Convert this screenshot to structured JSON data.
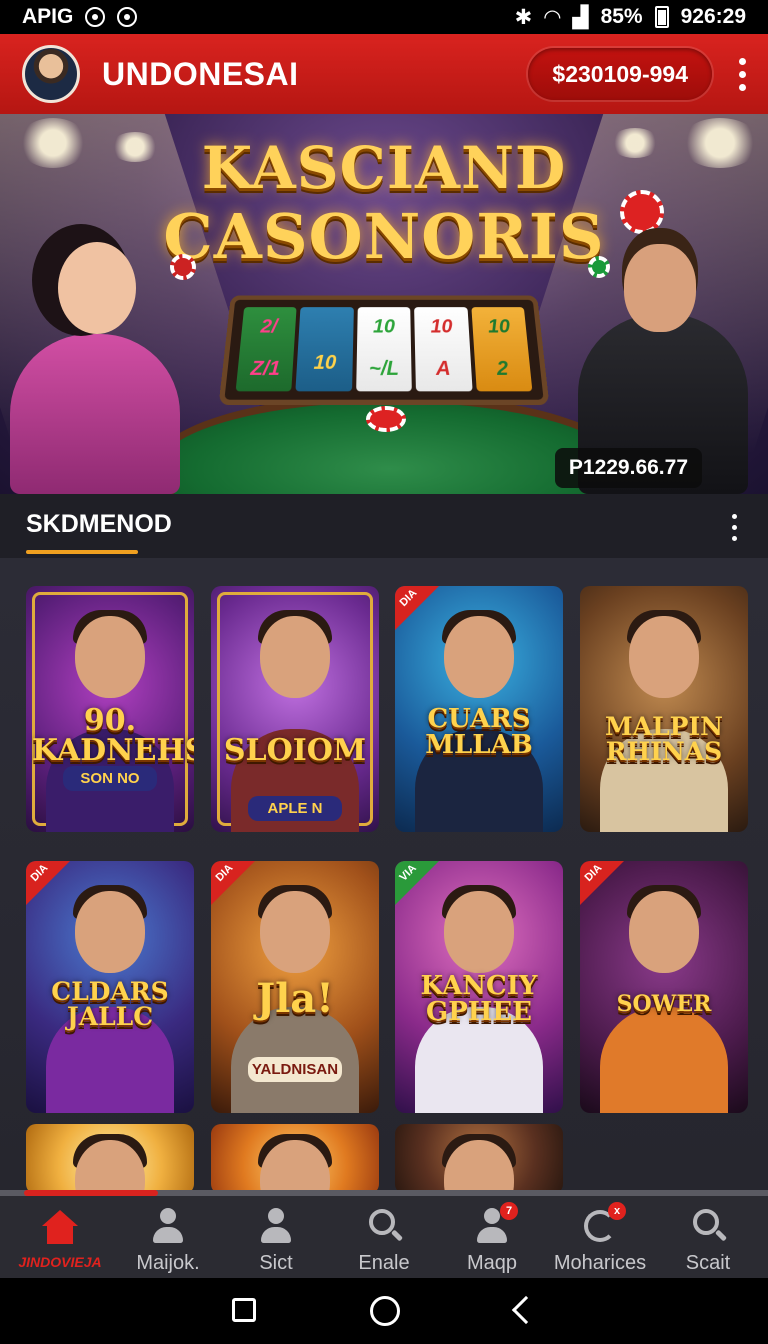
{
  "status_bar": {
    "carrier": "APIG",
    "battery_pct": "85%",
    "time": "926:29"
  },
  "header": {
    "title": "UNDONESAI",
    "balance": "$230109-994"
  },
  "hero": {
    "title_line1": "KASCIAND",
    "title_line2": "CASONORIS",
    "reels": [
      [
        "2/",
        "Z/1"
      ],
      [
        "",
        "10"
      ],
      [
        "10",
        "~/L"
      ],
      [
        "10",
        "A"
      ],
      [
        "10",
        "2"
      ]
    ],
    "amount": "P1229.66.77"
  },
  "section": {
    "title": "SKDMENOD"
  },
  "games": [
    {
      "logo": "90.\nKADNEHS!",
      "sub": "SON NO",
      "ribbon": "",
      "theme": "gold"
    },
    {
      "logo": "SLOIOM",
      "sub": "APLE N",
      "ribbon": "",
      "theme": "purple"
    },
    {
      "logo": "CUARS\nMLLAB",
      "sub": "",
      "ribbon": "DIA",
      "theme": "blue"
    },
    {
      "logo": "MALPIN\nRHINAS",
      "sub": "",
      "ribbon": "",
      "theme": "brown"
    },
    {
      "logo": "CLDARS\nJALLC",
      "sub": "",
      "ribbon": "DIA",
      "theme": "violet"
    },
    {
      "logo": "Jla!",
      "sub": "YALDNISAN",
      "ribbon": "DIA",
      "theme": "orange"
    },
    {
      "logo": "KANCIY\nGPHEE",
      "sub": "",
      "ribbon": "VIA",
      "theme": "magenta"
    },
    {
      "logo": "SOWER",
      "sub": "",
      "ribbon": "DIA",
      "theme": "night"
    },
    {
      "logo": "",
      "sub": "",
      "ribbon": "",
      "theme": "sun"
    },
    {
      "logo": "",
      "sub": "",
      "ribbon": "",
      "theme": "dawn"
    },
    {
      "logo": "",
      "sub": "",
      "ribbon": "",
      "theme": "dusk"
    }
  ],
  "scroll_progress": 0.2,
  "bottom_nav": [
    {
      "label": "JINDOVIEJA",
      "icon": "home-icon",
      "badge": ""
    },
    {
      "label": "Maijok.",
      "icon": "user-icon",
      "badge": ""
    },
    {
      "label": "Sict",
      "icon": "user-edit-icon",
      "badge": ""
    },
    {
      "label": "Enale",
      "icon": "search-icon",
      "badge": ""
    },
    {
      "label": "Maqp",
      "icon": "user-icon",
      "badge": "7"
    },
    {
      "label": "Moharices",
      "icon": "spin-icon",
      "badge": "x"
    },
    {
      "label": "Scait",
      "icon": "search-icon",
      "badge": ""
    }
  ],
  "colors": {
    "brand": "#d8231f",
    "accent": "#f0a020",
    "background": "#26262e"
  }
}
